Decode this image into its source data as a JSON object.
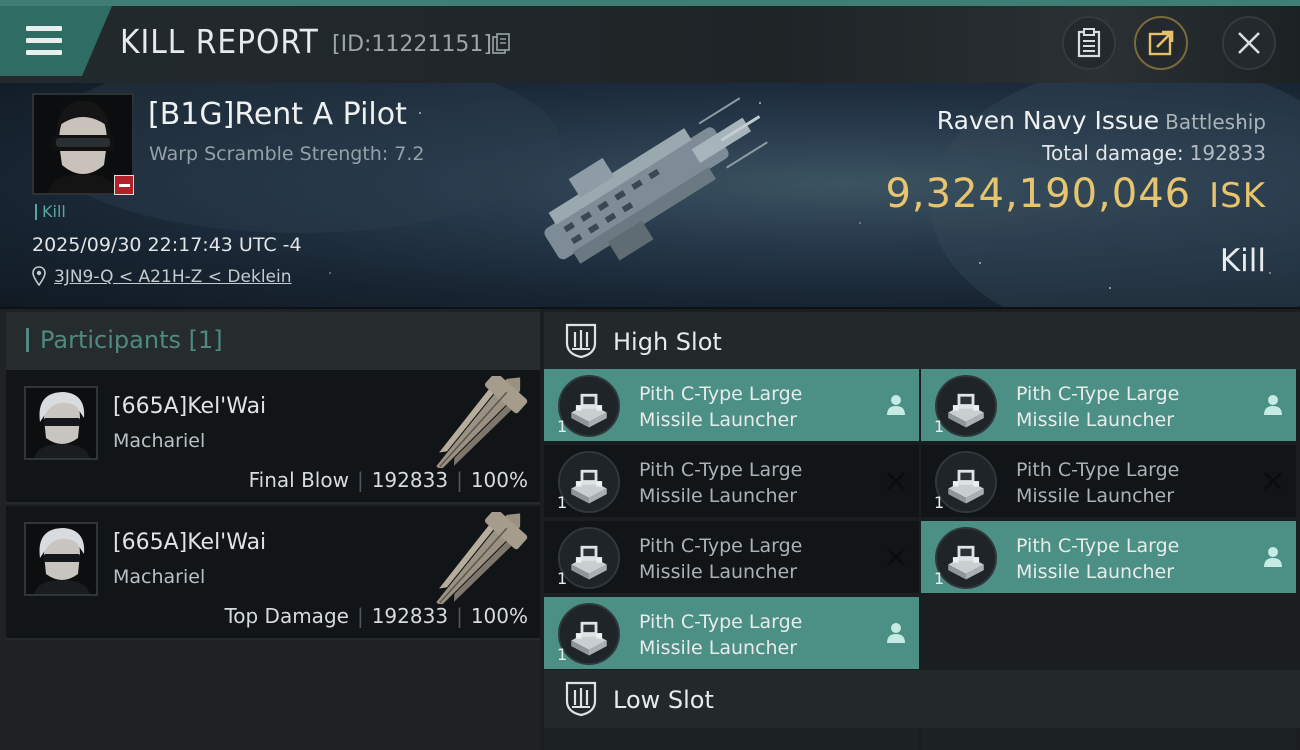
{
  "header": {
    "title": "KILL REPORT",
    "id_label": "[ID:11221151]",
    "buttons": [
      "clipboard",
      "share",
      "close"
    ]
  },
  "victim": {
    "name": "[B1G]Rent A Pilot",
    "warp_scramble": "Warp Scramble Strength: 7.2",
    "kill_tag": "Kill",
    "datetime": "2025/09/30 22:17:43 UTC -4",
    "location": "3JN9-Q < A21H-Z < Deklein"
  },
  "ship": {
    "name": "Raven Navy Issue",
    "class": "Battleship",
    "total_damage_label": "Total damage:",
    "total_damage": "192833",
    "isk_value": "9,324,190,046",
    "isk_unit": "ISK",
    "result": "Kill"
  },
  "participants": {
    "title": "Participants [1]",
    "rows": [
      {
        "name": "[665A]Kel'Wai",
        "ship": "Machariel",
        "role": "Final Blow",
        "damage": "192833",
        "percent": "100%"
      },
      {
        "name": "[665A]Kel'Wai",
        "ship": "Machariel",
        "role": "Top Damage",
        "damage": "192833",
        "percent": "100%"
      }
    ]
  },
  "high_slot": {
    "title": "High Slot",
    "modules": [
      {
        "line1": "Pith C-Type Large",
        "line2": "Missile Launcher",
        "qty": "1",
        "state": "dropped",
        "status_icon": "person-icon"
      },
      {
        "line1": "Pith C-Type Large",
        "line2": "Missile Launcher",
        "qty": "1",
        "state": "dropped",
        "status_icon": "person-icon"
      },
      {
        "line1": "Pith C-Type Large",
        "line2": "Missile Launcher",
        "qty": "1",
        "state": "destroyed",
        "status_icon": "x-icon"
      },
      {
        "line1": "Pith C-Type Large",
        "line2": "Missile Launcher",
        "qty": "1",
        "state": "destroyed",
        "status_icon": "x-icon"
      },
      {
        "line1": "Pith C-Type Large",
        "line2": "Missile Launcher",
        "qty": "1",
        "state": "destroyed",
        "status_icon": "x-icon"
      },
      {
        "line1": "Pith C-Type Large",
        "line2": "Missile Launcher",
        "qty": "1",
        "state": "dropped",
        "status_icon": "person-icon"
      },
      {
        "line1": "Pith C-Type Large",
        "line2": "Missile Launcher",
        "qty": "1",
        "state": "dropped",
        "status_icon": "person-icon"
      }
    ]
  },
  "low_slot": {
    "title": "Low Slot"
  },
  "colors": {
    "accent_teal": "#4c8f85",
    "isk_gold": "#e7c46e",
    "kill_red": "#b3202a"
  }
}
